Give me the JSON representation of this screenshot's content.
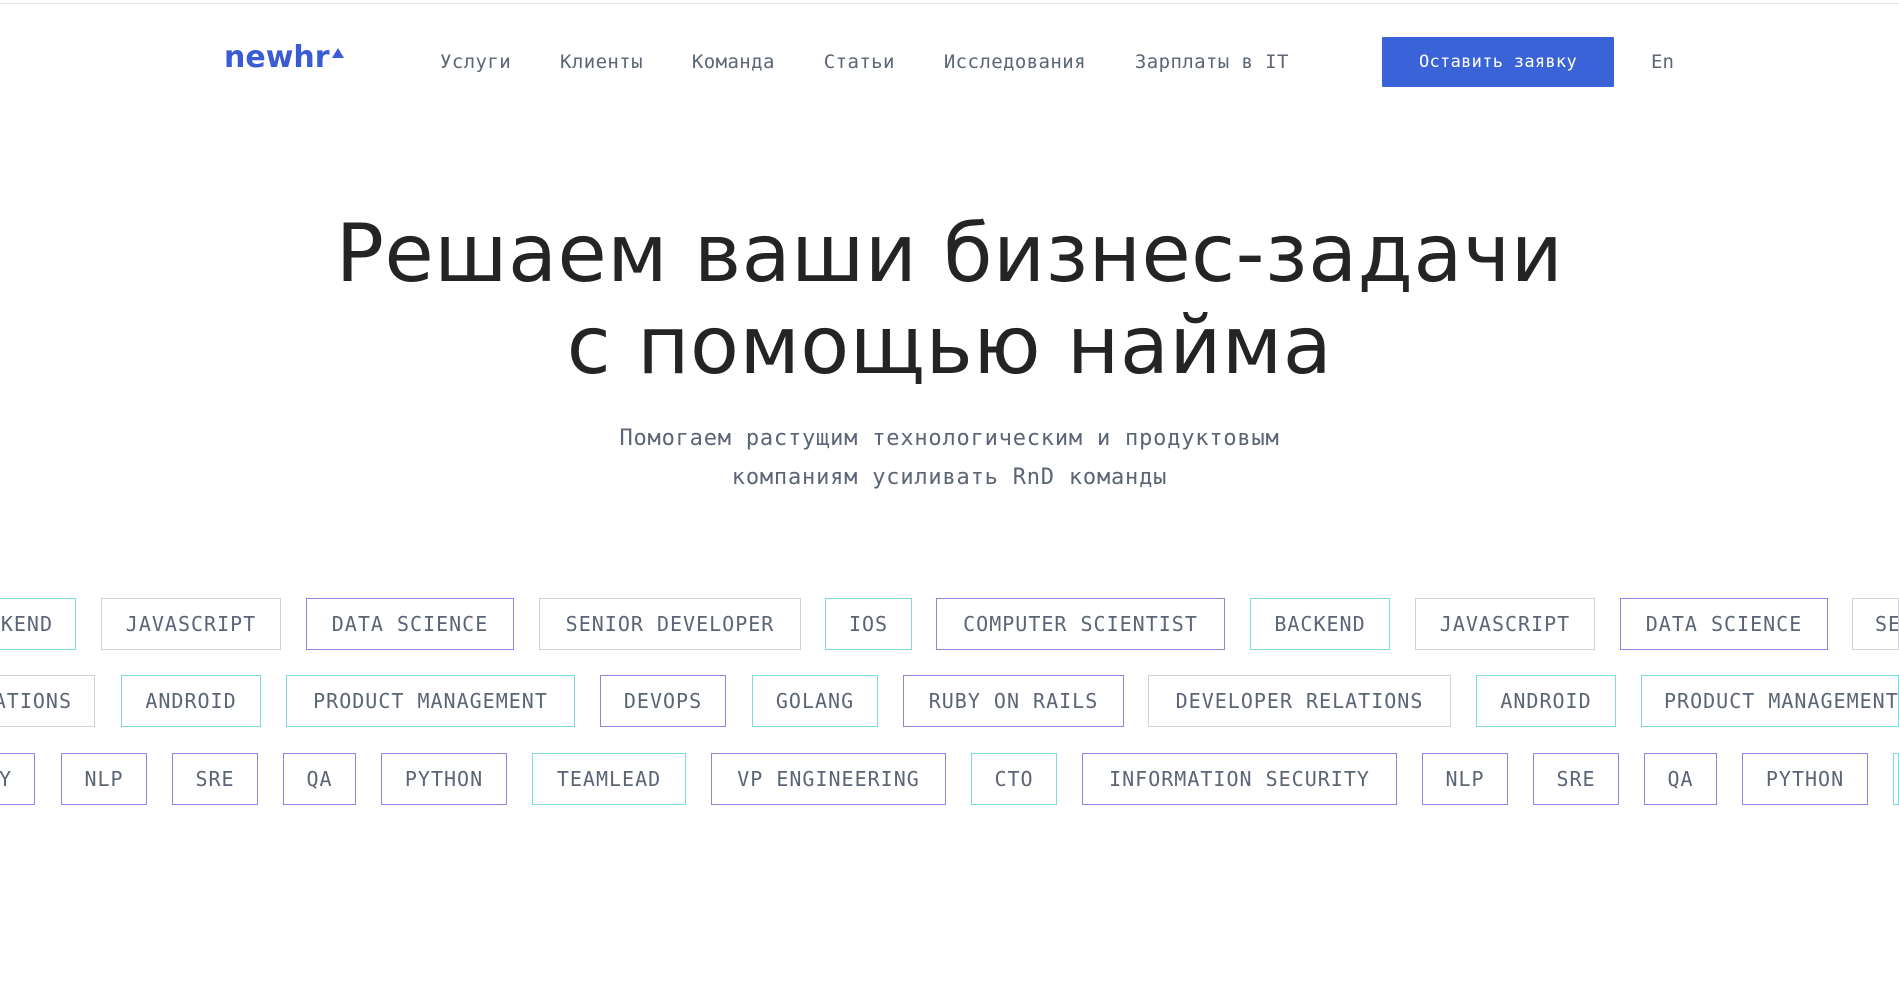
{
  "header": {
    "logo_text": "newhr",
    "nav": [
      "Услуги",
      "Клиенты",
      "Команда",
      "Статьи",
      "Исследования",
      "Зарплаты в IT"
    ],
    "cta_label": "Оставить заявку",
    "lang": "En"
  },
  "hero": {
    "title_line1": "Решаем ваши бизнес-задачи",
    "title_line2": "с помощью найма",
    "subtitle_line1": "Помогаем растущим технологическим и продуктовым",
    "subtitle_line2": "компаниям усиливать RnD команды"
  },
  "tags": {
    "row1": [
      "KEND",
      "JAVASCRIPT",
      "DATA SCIENCE",
      "SENIOR DEVELOPER",
      "IOS",
      "COMPUTER SCIENTIST",
      "BACKEND",
      "JAVASCRIPT",
      "DATA SCIENCE",
      "SE"
    ],
    "row2": [
      "ATIONS",
      "ANDROID",
      "PRODUCT MANAGEMENT",
      "DEVOPS",
      "GOLANG",
      "RUBY ON RAILS",
      "DEVELOPER RELATIONS",
      "ANDROID",
      "PRODUCT MANAGEMENT"
    ],
    "row3": [
      "Y",
      "NLP",
      "SRE",
      "QA",
      "PYTHON",
      "TEAMLEAD",
      "VP ENGINEERING",
      "CTO",
      "INFORMATION SECURITY",
      "NLP",
      "SRE",
      "QA",
      "PYTHON",
      ""
    ]
  },
  "colors": {
    "brand_blue": "#3a63d8",
    "logo_blue": "#3a5bd4",
    "tag_grey": "#cfd3d9",
    "tag_purple": "#8b86e0",
    "tag_teal": "#7fd9dc"
  }
}
